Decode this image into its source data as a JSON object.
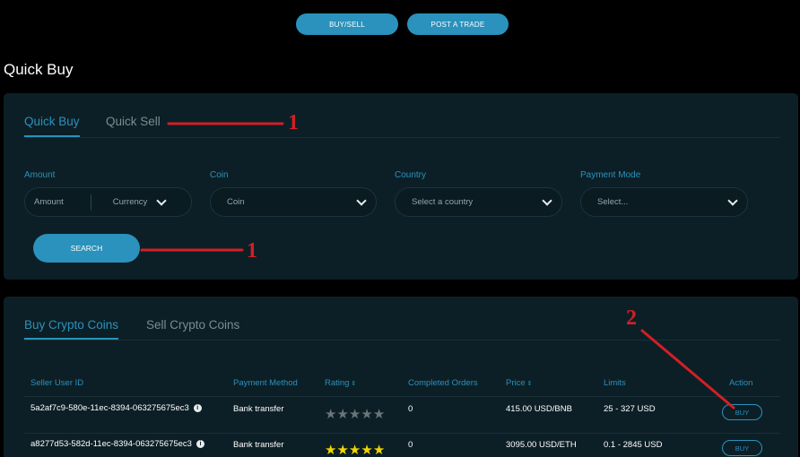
{
  "top_nav": {
    "buysell_label": "BUY/SELL",
    "post_trade_label": "POST A TRADE"
  },
  "page_title": "Quick Buy",
  "filter_panel": {
    "tabs": [
      {
        "label": "Quick Buy",
        "active": true
      },
      {
        "label": "Quick Sell",
        "active": false
      }
    ],
    "fields": {
      "amount": {
        "label": "Amount",
        "placeholder": "Amount",
        "currency": "Currency"
      },
      "coin": {
        "label": "Coin",
        "placeholder": "Coin"
      },
      "country": {
        "label": "Country",
        "placeholder": "Select a country"
      },
      "payment_mode": {
        "label": "Payment Mode",
        "placeholder": "Select..."
      }
    },
    "search_label": "SEARCH"
  },
  "table_panel": {
    "tabs": [
      {
        "label": "Buy Crypto Coins",
        "active": true
      },
      {
        "label": "Sell Crypto Coins",
        "active": false
      }
    ],
    "headers": {
      "seller": "Seller User ID",
      "payment": "Payment Method",
      "rating": "Rating",
      "orders": "Completed Orders",
      "price": "Price",
      "limits": "Limits",
      "action": "Action"
    },
    "sort_glyph": "⇕",
    "rows": [
      {
        "seller": "5a2af7c9-580e-11ec-8394-063275675ec3",
        "payment": "Bank transfer",
        "rating": 0,
        "orders": "0",
        "price": "415.00 USD/BNB",
        "limits": "25 - 327 USD",
        "action": "BUY"
      },
      {
        "seller": "a8277d53-582d-11ec-8394-063275675ec3",
        "payment": "Bank transfer",
        "rating": 5,
        "orders": "0",
        "price": "3095.00 USD/ETH",
        "limits": "0.1 - 2845 USD",
        "action": "BUY"
      }
    ]
  },
  "annotations": {
    "one_a": "1",
    "one_b": "1",
    "two": "2"
  },
  "colors": {
    "accent": "#2a92bc",
    "panel": "#0c1f26",
    "annotation": "#d21f25",
    "star_on": "#f2d600",
    "star_off": "#6b7478"
  }
}
